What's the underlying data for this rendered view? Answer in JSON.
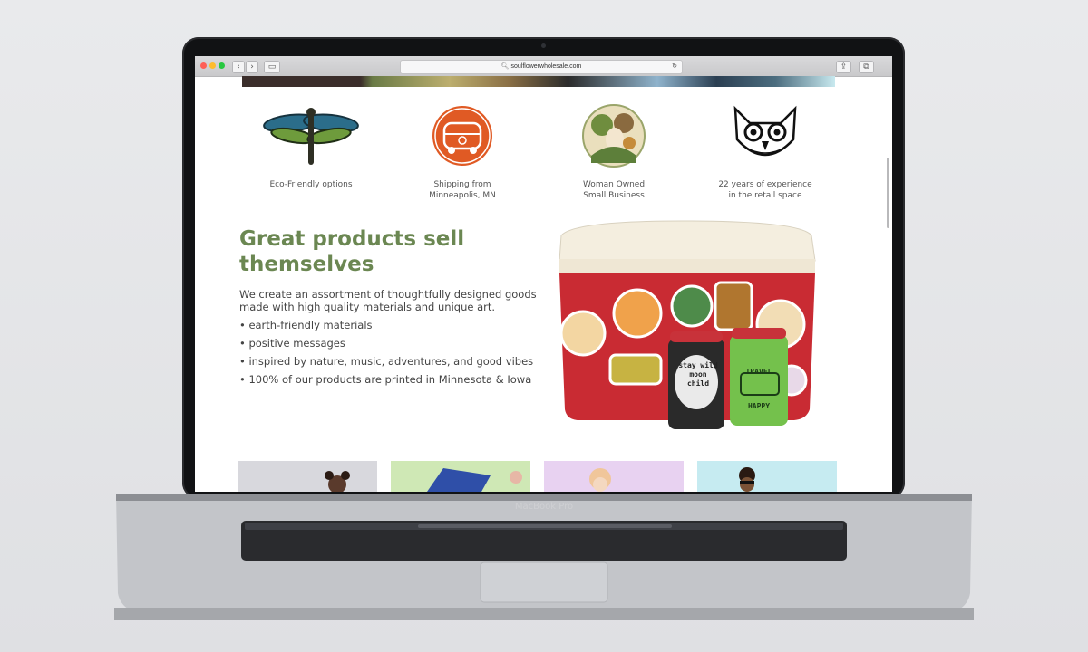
{
  "browser": {
    "url": "soulflowerwholesale.com",
    "buttons": {
      "back": "‹",
      "forward": "›",
      "sidebar": "▭",
      "reload": "↻",
      "share": "⇪",
      "tabs": "⧉"
    }
  },
  "features": [
    {
      "icon": "dragonfly-icon",
      "caption": "Eco-Friendly options"
    },
    {
      "icon": "van-icon",
      "caption": "Shipping from\nMinneapolis, MN"
    },
    {
      "icon": "woman-icon",
      "caption": "Woman Owned\nSmall Business"
    },
    {
      "icon": "owl-icon",
      "caption": "22 years of experience\nin the retail space"
    }
  ],
  "content": {
    "headline": "Great products sell themselves",
    "intro": "We create an assortment of thoughtfully designed goods made with high quality materials and unique art.",
    "bullets": [
      "• earth-friendly materials",
      "• positive messages",
      "• inspired by nature, music, adventures, and good vibes",
      "• 100% of our products are printed in Minnesota & Iowa"
    ],
    "koozie_left_text": "stay wild moon child",
    "koozie_right_text": "TRAVEL HAPPY"
  },
  "laptop": {
    "brand": "MacBook Pro"
  },
  "colors": {
    "accent": "#6b8752",
    "text": "#444444",
    "van_orange": "#e05a24",
    "cooler_red": "#c92b33"
  }
}
